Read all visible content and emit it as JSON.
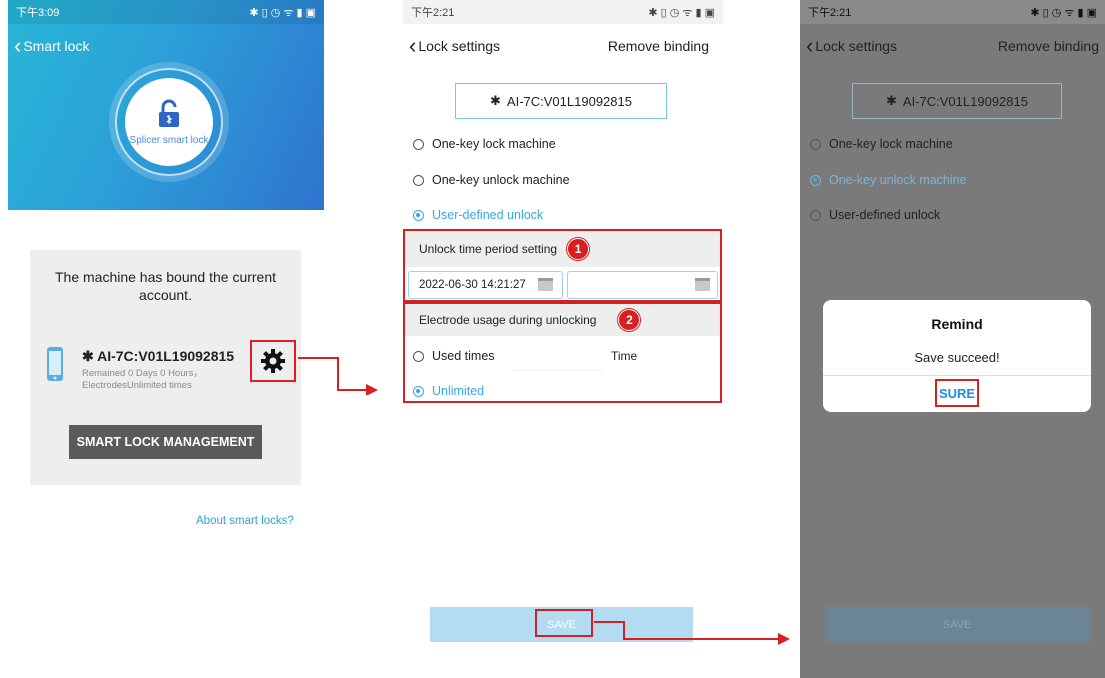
{
  "screen1": {
    "status": {
      "time": "下午3:09",
      "icons": "✱ ▯ ◷ ᯤ ▮ ▣"
    },
    "nav": {
      "back_icon": "chevron-left-icon",
      "title": "Smart lock"
    },
    "lock_label": "Splicer smart lock",
    "bound_text": "The machine has bound the current account.",
    "device_name": "AI-7C:V01L19092815",
    "remain_text": "Remained 0 Days 0 Hours，ElectrodesUnlimited times",
    "management_button": "SMART LOCK MANAGEMENT",
    "about_link": "About smart locks?"
  },
  "screen2": {
    "status": {
      "time": "下午2:21",
      "icons": "✱ ▯ ◷ ᯤ ▮ ▣"
    },
    "nav": {
      "title": "Lock settings",
      "action": "Remove binding"
    },
    "device_name": "AI-7C:V01L19092815",
    "options": [
      {
        "label": "One-key lock machine",
        "selected": false
      },
      {
        "label": "One-key unlock machine",
        "selected": false
      },
      {
        "label": "User-defined unlock",
        "selected": true
      }
    ],
    "time_section": {
      "title": "Unlock time period setting",
      "badge": "1",
      "start": "2022-06-30 14:21:27",
      "end": ""
    },
    "electrode_section": {
      "title": "Electrode usage during unlocking",
      "badge": "2",
      "used_times_label": "Used times",
      "used_times_value": "",
      "time_unit": "Time",
      "unlimited_label": "Unlimited",
      "selected": "Unlimited"
    },
    "save_button": "SAVE"
  },
  "screen3": {
    "status": {
      "time": "下午2:21",
      "icons": "✱ ▯ ◷ ᯤ ▮ ▣"
    },
    "nav": {
      "title": "Lock settings",
      "action": "Remove binding"
    },
    "device_name": "AI-7C:V01L19092815",
    "options": [
      {
        "label": "One-key lock machine",
        "selected": false
      },
      {
        "label": "One-key unlock machine",
        "selected": true
      },
      {
        "label": "User-defined unlock",
        "selected": false
      }
    ],
    "dialog": {
      "title": "Remind",
      "message": "Save succeed!",
      "button": "SURE"
    },
    "save_button": "SAVE"
  },
  "colors": {
    "accent": "#3aa7e0",
    "highlight": "#d32020",
    "save_bg": "#b3dcf2",
    "gradient_start": "#27b7d6",
    "gradient_end": "#2f73cf"
  }
}
